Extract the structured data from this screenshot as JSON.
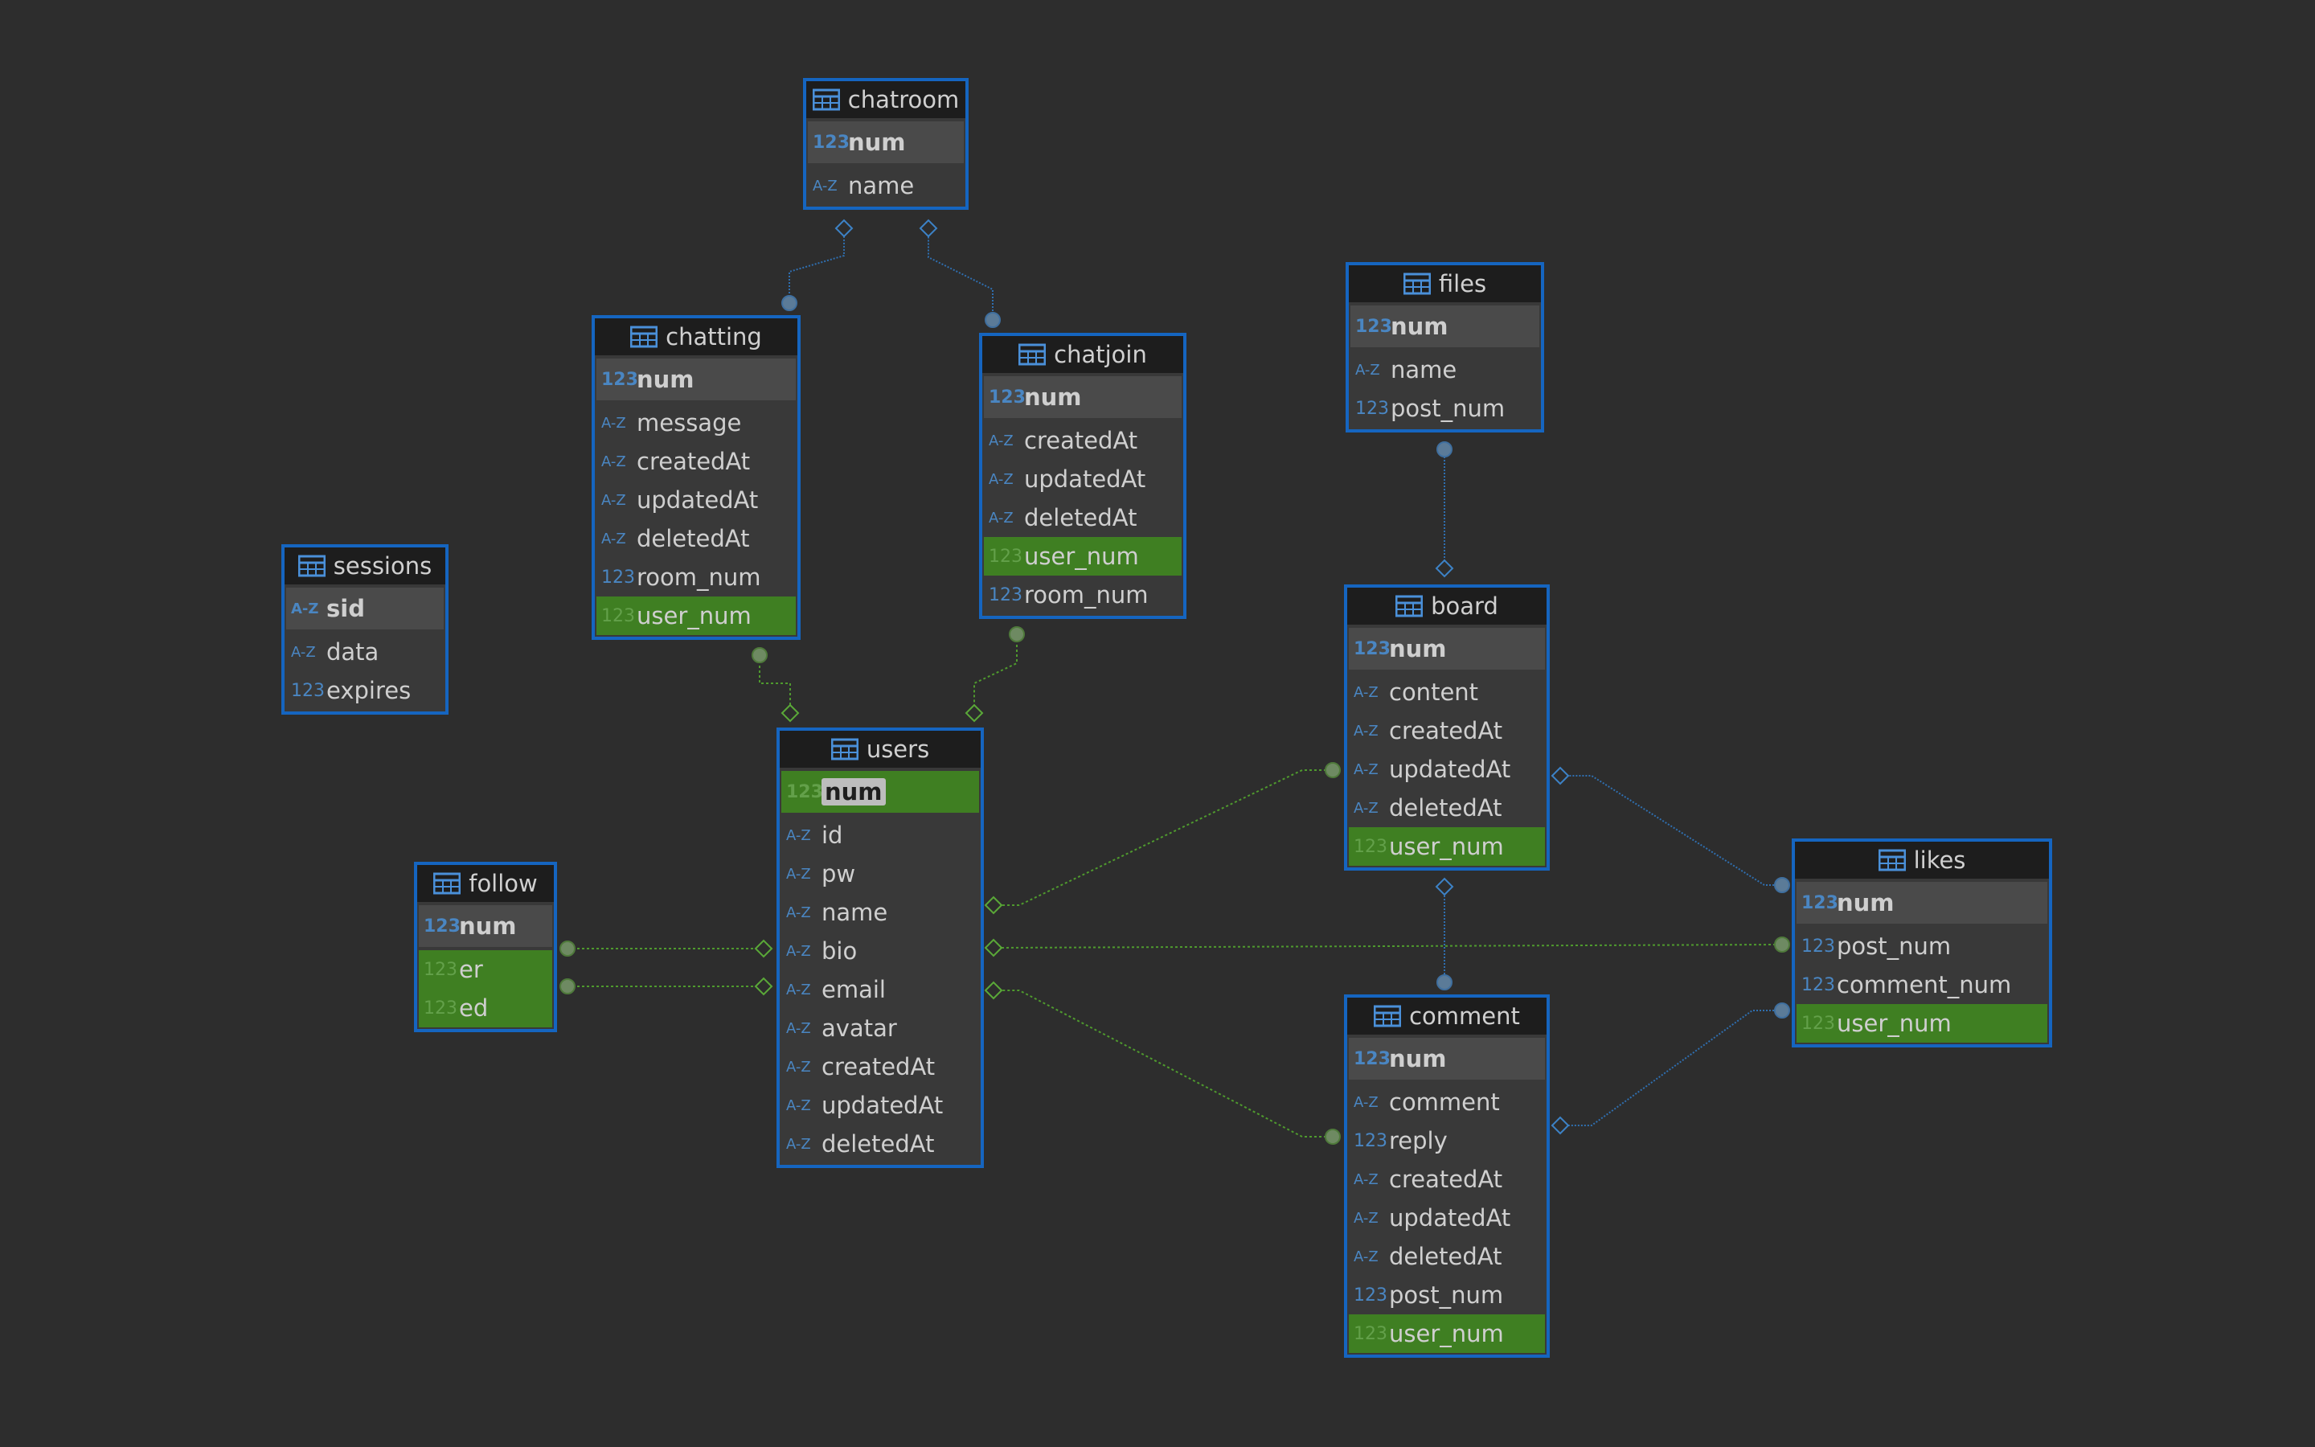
{
  "tables": [
    {
      "id": "chatroom",
      "name": "chatroom",
      "columns": [
        {
          "name": "num",
          "type": "num",
          "pk": true
        },
        {
          "name": "name",
          "type": "text"
        }
      ]
    },
    {
      "id": "chatting",
      "name": "chatting",
      "columns": [
        {
          "name": "num",
          "type": "num",
          "pk": true
        },
        {
          "name": "message",
          "type": "text"
        },
        {
          "name": "createdAt",
          "type": "text"
        },
        {
          "name": "updatedAt",
          "type": "text"
        },
        {
          "name": "deletedAt",
          "type": "text"
        },
        {
          "name": "room_num",
          "type": "num"
        },
        {
          "name": "user_num",
          "type": "num",
          "fk": true
        }
      ]
    },
    {
      "id": "chatjoin",
      "name": "chatjoin",
      "columns": [
        {
          "name": "num",
          "type": "num",
          "pk": true
        },
        {
          "name": "createdAt",
          "type": "text"
        },
        {
          "name": "updatedAt",
          "type": "text"
        },
        {
          "name": "deletedAt",
          "type": "text"
        },
        {
          "name": "user_num",
          "type": "num",
          "fk": true
        },
        {
          "name": "room_num",
          "type": "num"
        }
      ]
    },
    {
      "id": "files",
      "name": "files",
      "columns": [
        {
          "name": "num",
          "type": "num",
          "pk": true
        },
        {
          "name": "name",
          "type": "text"
        },
        {
          "name": "post_num",
          "type": "num"
        }
      ]
    },
    {
      "id": "sessions",
      "name": "sessions",
      "columns": [
        {
          "name": "sid",
          "type": "text",
          "pk": true
        },
        {
          "name": "data",
          "type": "text"
        },
        {
          "name": "expires",
          "type": "num"
        }
      ]
    },
    {
      "id": "board",
      "name": "board",
      "columns": [
        {
          "name": "num",
          "type": "num",
          "pk": true
        },
        {
          "name": "content",
          "type": "text"
        },
        {
          "name": "createdAt",
          "type": "text"
        },
        {
          "name": "updatedAt",
          "type": "text"
        },
        {
          "name": "deletedAt",
          "type": "text"
        },
        {
          "name": "user_num",
          "type": "num",
          "fk": true
        }
      ]
    },
    {
      "id": "users",
      "name": "users",
      "columns": [
        {
          "name": "num",
          "type": "num",
          "pk": true,
          "fk": true,
          "highlight": true
        },
        {
          "name": "id",
          "type": "text"
        },
        {
          "name": "pw",
          "type": "text"
        },
        {
          "name": "name",
          "type": "text"
        },
        {
          "name": "bio",
          "type": "text"
        },
        {
          "name": "email",
          "type": "text"
        },
        {
          "name": "avatar",
          "type": "text"
        },
        {
          "name": "createdAt",
          "type": "text"
        },
        {
          "name": "updatedAt",
          "type": "text"
        },
        {
          "name": "deletedAt",
          "type": "text"
        }
      ]
    },
    {
      "id": "follow",
      "name": "follow",
      "columns": [
        {
          "name": "num",
          "type": "num",
          "pk": true
        },
        {
          "name": "er",
          "type": "num",
          "fk": true
        },
        {
          "name": "ed",
          "type": "num",
          "fk": true
        }
      ]
    },
    {
      "id": "likes",
      "name": "likes",
      "columns": [
        {
          "name": "num",
          "type": "num",
          "pk": true
        },
        {
          "name": "post_num",
          "type": "num"
        },
        {
          "name": "comment_num",
          "type": "num"
        },
        {
          "name": "user_num",
          "type": "num",
          "fk": true
        }
      ]
    },
    {
      "id": "comment",
      "name": "comment",
      "columns": [
        {
          "name": "num",
          "type": "num",
          "pk": true
        },
        {
          "name": "comment",
          "type": "text"
        },
        {
          "name": "reply",
          "type": "num"
        },
        {
          "name": "createdAt",
          "type": "text"
        },
        {
          "name": "updatedAt",
          "type": "text"
        },
        {
          "name": "deletedAt",
          "type": "text"
        },
        {
          "name": "post_num",
          "type": "num"
        },
        {
          "name": "user_num",
          "type": "num",
          "fk": true
        }
      ]
    }
  ],
  "type_icons": {
    "num": "123",
    "text": "A-Z"
  },
  "relations": [
    {
      "from": "chatting",
      "to": "chatroom",
      "kind": "blue"
    },
    {
      "from": "chatjoin",
      "to": "chatroom",
      "kind": "blue"
    },
    {
      "from": "board",
      "to": "files",
      "kind": "blue"
    },
    {
      "from": "comment",
      "to": "board",
      "kind": "blue"
    },
    {
      "from": "likes",
      "to": "board",
      "kind": "blue"
    },
    {
      "from": "likes",
      "to": "comment",
      "kind": "blue"
    },
    {
      "from": "chatting",
      "to": "users",
      "kind": "green"
    },
    {
      "from": "chatjoin",
      "to": "users",
      "kind": "green"
    },
    {
      "from": "follow",
      "to": "users",
      "kind": "green"
    },
    {
      "from": "follow",
      "to": "users",
      "kind": "green"
    },
    {
      "from": "board",
      "to": "users",
      "kind": "green"
    },
    {
      "from": "likes",
      "to": "users",
      "kind": "green"
    },
    {
      "from": "comment",
      "to": "users",
      "kind": "green"
    }
  ],
  "colors": {
    "background": "#2d2d2d",
    "table_border": "#1565c0",
    "header_bg": "#1d1d1d",
    "fk_row": "#3f7f22",
    "blue_link": "#2f6fb0",
    "green_link": "#4f9a2e"
  }
}
